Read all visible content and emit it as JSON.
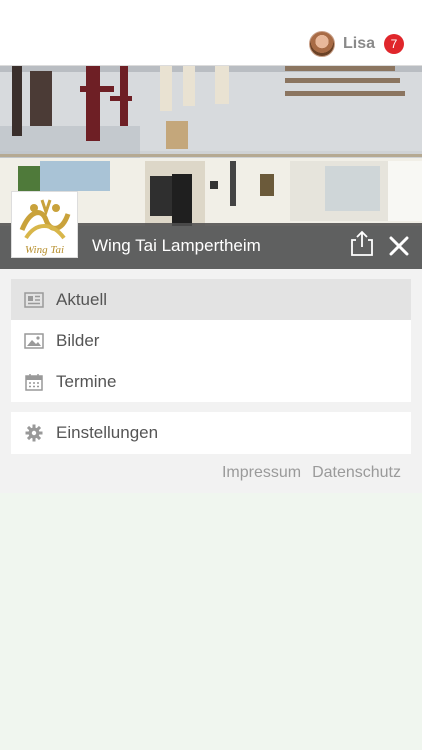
{
  "user": {
    "name": "Lisa",
    "notifications": "7",
    "avatar_icon": "user-avatar"
  },
  "hero": {
    "title": "Wing Tai Lampertheim",
    "logo_text": "Wing Tai",
    "share_icon": "share-icon",
    "close_icon": "close-icon"
  },
  "menu": {
    "primary": [
      {
        "label": "Aktuell",
        "icon": "newspaper-icon",
        "active": true
      },
      {
        "label": "Bilder",
        "icon": "image-icon",
        "active": false
      },
      {
        "label": "Termine",
        "icon": "calendar-icon",
        "active": false
      }
    ],
    "secondary": [
      {
        "label": "Einstellungen",
        "icon": "gear-icon",
        "active": false
      }
    ]
  },
  "footer_links": {
    "impressum": "Impressum",
    "datenschutz": "Datenschutz"
  },
  "colors": {
    "badge": "#e0262b",
    "hero_bar": "#505050",
    "page_bg": "#f0f6ef",
    "active_item": "#e3e3e3"
  }
}
